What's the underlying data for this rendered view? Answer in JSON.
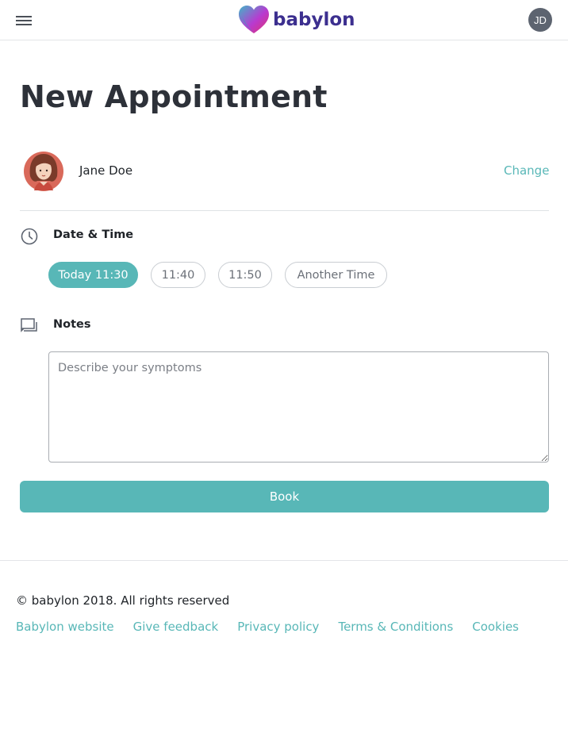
{
  "colors": {
    "accent": "#58b7b7",
    "brand": "#3c2f8f",
    "title": "#2d3139",
    "avatar_bg": "#5d6470"
  },
  "header": {
    "menu_icon": "hamburger-menu-icon",
    "logo_text": "babylon",
    "user_initials": "JD"
  },
  "page": {
    "title": "New Appointment"
  },
  "patient": {
    "name": "Jane Doe",
    "change_label": "Change"
  },
  "datetime": {
    "icon": "clock-icon",
    "label": "Date & Time",
    "options": [
      "Today 11:30",
      "11:40",
      "11:50",
      "Another Time"
    ],
    "selected": "Today 11:30"
  },
  "notes": {
    "icon": "chat-icon",
    "label": "Notes",
    "placeholder": "Describe your symptoms",
    "value": ""
  },
  "actions": {
    "book_label": "Book"
  },
  "footer": {
    "copyright": "© babylon 2018. All rights reserved",
    "links": [
      "Babylon website",
      "Give feedback",
      "Privacy policy",
      "Terms & Conditions",
      "Cookies"
    ]
  }
}
